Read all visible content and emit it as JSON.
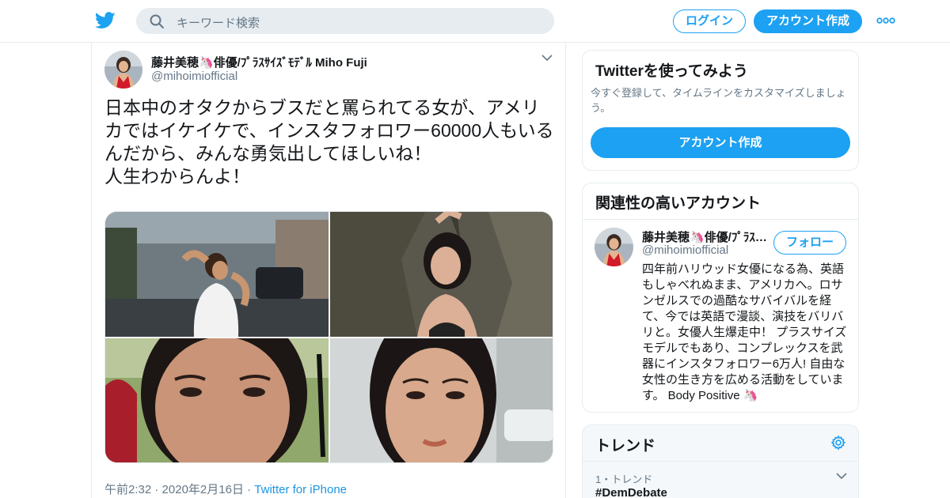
{
  "header": {
    "logo_icon": "twitter-bird-icon",
    "search_placeholder": "キーワード検索",
    "login_label": "ログイン",
    "signup_label": "アカウント作成",
    "more_icon": "more-dots-icon",
    "accent_color": "#1da1f2"
  },
  "tweet": {
    "author_name": "藤井美穂🦄俳優/ﾌﾟﾗｽｻｲｽﾞﾓﾃﾞﾙ Miho Fuji",
    "author_handle": "@mihoimiofficial",
    "text_lines": [
      "日本中のオタクからブスだと罵られてる女が、アメリカではイケイケで、インスタフォロワー60000人もいるんだから、みんな勇気出してほしいね！",
      "人生わからんよ！"
    ],
    "photos": [
      "photo-1",
      "photo-2",
      "photo-3",
      "photo-4"
    ],
    "time": "午前2:32",
    "date": "2020年2月16日",
    "separator": "·",
    "source": "Twitter for iPhone"
  },
  "signup_card": {
    "title": "Twitterを使ってみよう",
    "description": "今すぐ登録して、タイムラインをカスタマイズしましょう。",
    "button_label": "アカウント作成"
  },
  "related_card": {
    "title": "関連性の高いアカウント",
    "name": "藤井美穂🦄俳優/ﾌﾟﾗｽｻｲｽﾞﾓﾃﾞﾙ Miho Fuji",
    "handle": "@mihoimiofficial",
    "follow_label": "フォロー",
    "bio": "四年前ハリウッド女優になる為、英語もしゃべれぬまま、アメリカへ。ロサンゼルスでの過酷なサバイバルを経て、今では英語で漫談、演技をバリバリと。女優人生爆走中！ プラスサイズモデルでもあり、コンプレックスを武器にインスタフォロワー6万人! 自由な女性の生き方を広める活動をしています。 Body Positive 🦄"
  },
  "trends": {
    "title": "トレンド",
    "settings_icon": "gear-icon",
    "items": [
      {
        "meta": "1・トレンド",
        "tag": "#DemDebate"
      }
    ]
  }
}
